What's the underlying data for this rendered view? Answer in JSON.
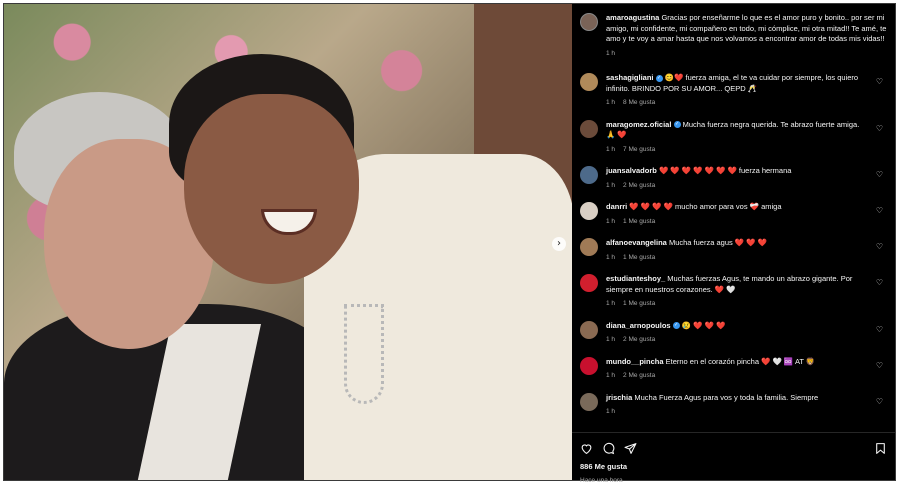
{
  "caption": {
    "username": "amaroagustina",
    "text": "Gracias por enseñarme lo que es el amor puro y bonito.. por ser mi amigo, mi confidente, mi compañero en todo, mi cómplice, mi otra mitad!! Te amé, te amo y te voy a amar hasta que nos volvamos a encontrar amor de todas mis vidas!!",
    "time": "1 h"
  },
  "comments": [
    {
      "username": "sashagigliani",
      "verified": true,
      "text": "😊❤️ fuerza amiga, el te va cuidar por siempre, los quiero infinito. BRINDO POR SU AMOR... QEPD 🥂",
      "time": "1 h",
      "likes": "8 Me gusta",
      "avatar_color": "#b08a5a"
    },
    {
      "username": "maragomez.oficial",
      "verified": true,
      "text": "Mucha fuerza negra querida. Te abrazo fuerte amiga. 🙏 ❤️",
      "time": "1 h",
      "likes": "7 Me gusta",
      "avatar_color": "#6b4b3a"
    },
    {
      "username": "juansalvadorb",
      "verified": false,
      "text": "❤️ ❤️ ❤️ ❤️ ❤️ ❤️ ❤️ fuerza hermana",
      "time": "1 h",
      "likes": "2 Me gusta",
      "avatar_color": "#4d6a8a"
    },
    {
      "username": "danrri",
      "verified": false,
      "text": "❤️ ❤️ ❤️ ❤️ mucho amor para vos ❤️‍🩹 amiga",
      "time": "1 h",
      "likes": "1 Me gusta",
      "avatar_color": "#d9cfc4"
    },
    {
      "username": "alfanoevangelina",
      "verified": false,
      "text": "Mucha fuerza agus ❤️ ❤️ ❤️",
      "time": "1 h",
      "likes": "1 Me gusta",
      "avatar_color": "#a07a56"
    },
    {
      "username": "estudianteshoy_",
      "verified": false,
      "text": "Muchas fuerzas Agus, te mando un abrazo gigante. Por siempre en nuestros corazones. ❤️ 🤍",
      "time": "1 h",
      "likes": "1 Me gusta",
      "avatar_color": "#d11f2e"
    },
    {
      "username": "diana_arnopoulos",
      "verified": true,
      "text": "😢 ❤️ ❤️ ❤️",
      "time": "1 h",
      "likes": "2 Me gusta",
      "avatar_color": "#8a6a52"
    },
    {
      "username": "mundo__pincha",
      "verified": false,
      "text": "Eterno en el corazón pincha ❤️ 🤍 ♾️ AT 🦁",
      "time": "1 h",
      "likes": "2 Me gusta",
      "avatar_color": "#c8102e"
    },
    {
      "username": "jrischia",
      "verified": false,
      "text": "Mucha Fuerza Agus para vos y toda la familia. Siempre",
      "time": "1 h",
      "likes": "",
      "avatar_color": "#7a6a5a"
    }
  ],
  "footer": {
    "likes": "886 Me gusta",
    "time": "Hace una hora"
  },
  "icons": [
    "heart-icon",
    "comment-icon",
    "share-icon",
    "bookmark-icon",
    "next-arrow-icon"
  ]
}
